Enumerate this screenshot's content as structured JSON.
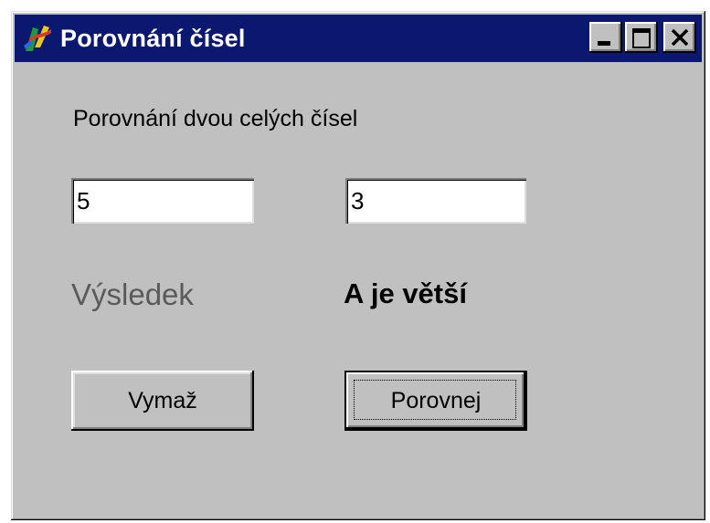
{
  "window": {
    "title": "Porovnání čísel",
    "icon": "app-icon"
  },
  "form": {
    "caption": "Porovnání dvou celých čísel",
    "input_a": "5",
    "input_b": "3",
    "result_label": "Výsledek",
    "result_value": "A je větší",
    "clear_button": "Vymaž",
    "compare_button": "Porovnej"
  },
  "colors": {
    "titlebar": "#0a1870",
    "window_face": "#c0c0c0"
  }
}
